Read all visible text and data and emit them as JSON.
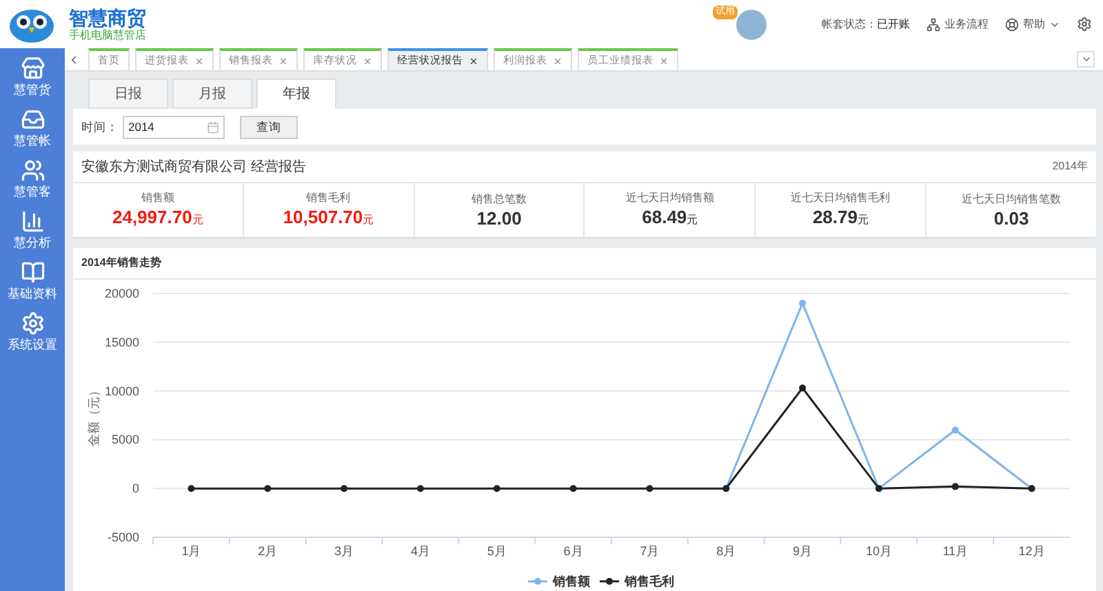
{
  "brand": {
    "title": "智慧商贸",
    "subtitle": "手机电脑慧管店"
  },
  "header": {
    "badge": "试用",
    "status_label": "帐套状态：",
    "status_value": "已开账",
    "links": [
      {
        "kind": "flow",
        "label": "业务流程",
        "caret": false
      },
      {
        "kind": "help",
        "label": "帮助",
        "caret": true
      }
    ]
  },
  "sidebar": {
    "items": [
      {
        "kind": "store",
        "label": "慧管货"
      },
      {
        "kind": "account",
        "label": "慧管帐"
      },
      {
        "kind": "customer",
        "label": "慧管客"
      },
      {
        "kind": "analysis",
        "label": "慧分析"
      },
      {
        "kind": "book",
        "label": "基础资料"
      },
      {
        "kind": "settings",
        "label": "系统设置"
      }
    ]
  },
  "tabs": [
    {
      "label": "首页",
      "closable": false,
      "selected": false
    },
    {
      "label": "进货报表",
      "closable": true,
      "selected": false
    },
    {
      "label": "销售报表",
      "closable": true,
      "selected": false
    },
    {
      "label": "库存状况",
      "closable": true,
      "selected": false
    },
    {
      "label": "经营状况报告",
      "closable": true,
      "selected": true
    },
    {
      "label": "利润报表",
      "closable": true,
      "selected": false
    },
    {
      "label": "员工业绩报表",
      "closable": true,
      "selected": false
    }
  ],
  "period_tabs": [
    {
      "label": "日报",
      "selected": false
    },
    {
      "label": "月报",
      "selected": false
    },
    {
      "label": "年报",
      "selected": true
    }
  ],
  "query": {
    "label": "时间：",
    "value": "2014",
    "button": "查询"
  },
  "report": {
    "title": "安徽东方测试商贸有限公司 经营报告",
    "year": "2014年",
    "stats": [
      {
        "label": "销售额",
        "value": "24,997.70",
        "unit": "元",
        "highlight": true
      },
      {
        "label": "销售毛利",
        "value": "10,507.70",
        "unit": "元",
        "highlight": true
      },
      {
        "label": "销售总笔数",
        "value": "12.00",
        "highlight": false
      },
      {
        "label": "近七天日均销售额",
        "value": "68.49",
        "unit": "元",
        "highlight": false
      },
      {
        "label": "近七天日均销售毛利",
        "value": "28.79",
        "unit": "元",
        "highlight": false
      },
      {
        "label": "近七天日均销售笔数",
        "value": "0.03",
        "highlight": false
      }
    ]
  },
  "chart": {
    "title": "2014年销售走势",
    "chart_data": {
      "type": "line",
      "ylabel": "金额（元）",
      "categories": [
        "1月",
        "2月",
        "3月",
        "4月",
        "5月",
        "6月",
        "7月",
        "8月",
        "9月",
        "10月",
        "11月",
        "12月"
      ],
      "ylim": [
        -5000,
        20000
      ],
      "yticks": [
        -5000,
        0,
        5000,
        10000,
        15000,
        20000
      ],
      "grid": true,
      "legend": true,
      "series": [
        {
          "name": "销售额",
          "color": "#7cb5ec",
          "marker": "circle",
          "values": [
            null,
            null,
            null,
            null,
            null,
            null,
            null,
            0,
            19000,
            0,
            6000,
            0
          ]
        },
        {
          "name": "销售毛利",
          "color": "#222222",
          "marker": "circle",
          "values": [
            0,
            0,
            0,
            0,
            0,
            0,
            0,
            0,
            10300,
            0,
            200,
            0
          ]
        }
      ]
    }
  }
}
